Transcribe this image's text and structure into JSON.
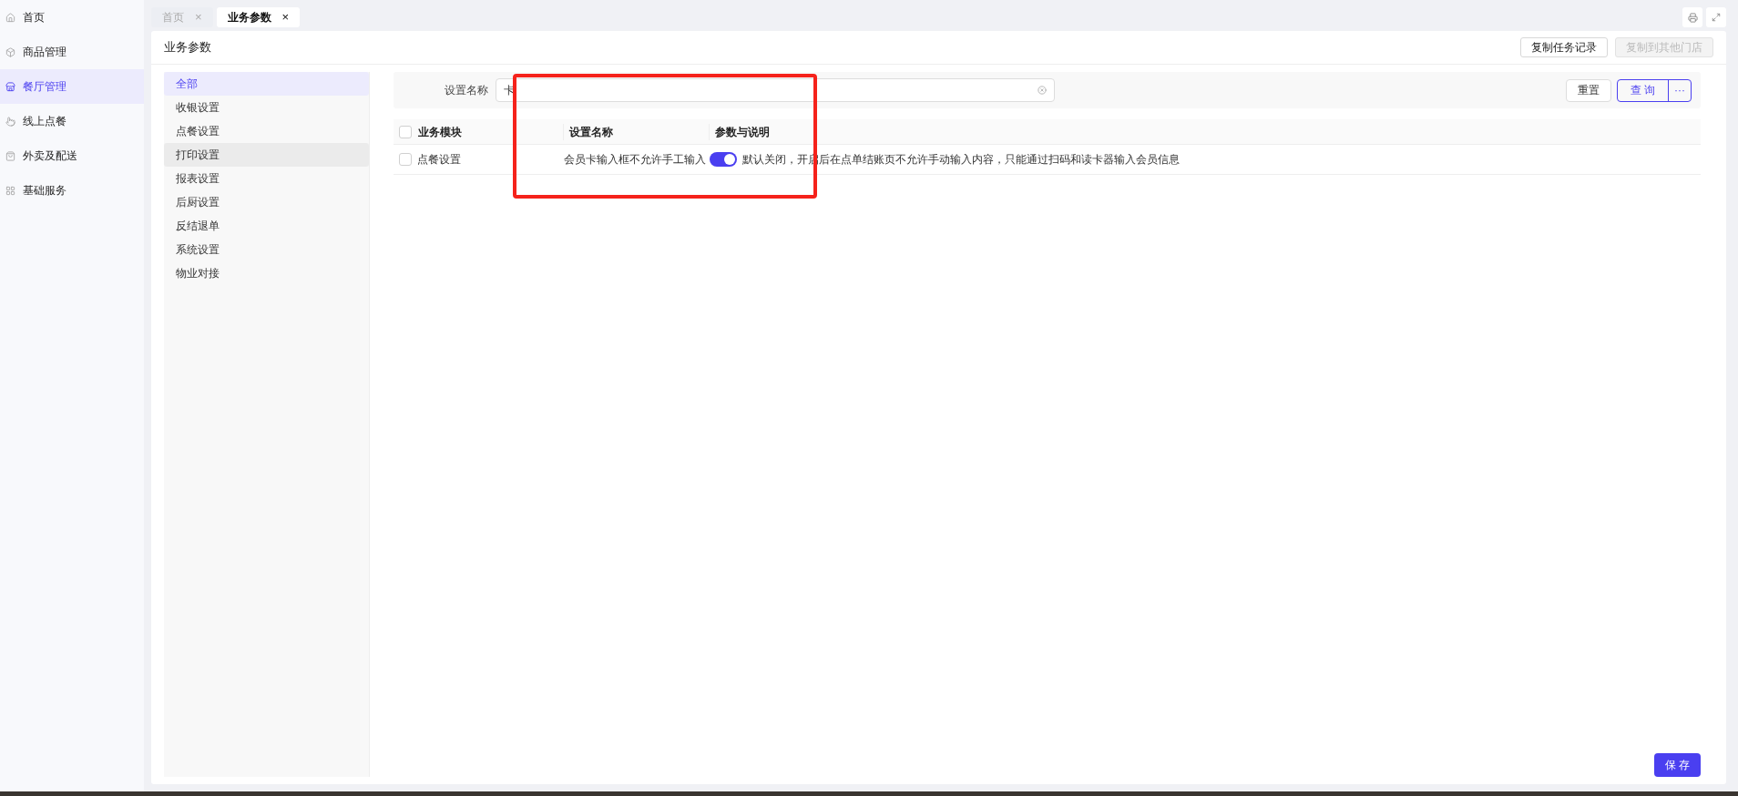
{
  "sidebar": {
    "items": [
      {
        "label": "首页",
        "selected": false
      },
      {
        "label": "商品管理",
        "selected": false
      },
      {
        "label": "餐厅管理",
        "selected": true
      },
      {
        "label": "线上点餐",
        "selected": false
      },
      {
        "label": "外卖及配送",
        "selected": false
      },
      {
        "label": "基础服务",
        "selected": false
      }
    ]
  },
  "tabs": [
    {
      "label": "首页",
      "close": "×",
      "selected": false
    },
    {
      "label": "业务参数",
      "close": "×",
      "selected": true
    }
  ],
  "page": {
    "title": "业务参数",
    "buttons": [
      {
        "label": "复制任务记录",
        "disabled": false
      },
      {
        "label": "复制到其他门店",
        "disabled": true
      }
    ]
  },
  "categories": [
    {
      "label": "全部",
      "selected": true,
      "hovered": false
    },
    {
      "label": "收银设置",
      "selected": false,
      "hovered": false
    },
    {
      "label": "点餐设置",
      "selected": false,
      "hovered": false
    },
    {
      "label": "打印设置",
      "selected": false,
      "hovered": true
    },
    {
      "label": "报表设置",
      "selected": false,
      "hovered": false
    },
    {
      "label": "后厨设置",
      "selected": false,
      "hovered": false
    },
    {
      "label": "反结退单",
      "selected": false,
      "hovered": false
    },
    {
      "label": "系统设置",
      "selected": false,
      "hovered": false
    },
    {
      "label": "物业对接",
      "selected": false,
      "hovered": false
    }
  ],
  "filter": {
    "label": "设置名称",
    "value": "卡",
    "reset": "重置",
    "query": "查 询",
    "more": "···"
  },
  "table": {
    "columns": [
      "业务模块",
      "设置名称",
      "参数与说明"
    ],
    "header_checked": false,
    "rows": [
      {
        "checked": false,
        "module": "点餐设置",
        "name": "会员卡输入框不允许手工输入",
        "on": true,
        "description": "默认关闭，开启后在点单结账页不允许手动输入内容，只能通过扫码和读卡器输入会员信息"
      }
    ]
  },
  "save": "保 存"
}
